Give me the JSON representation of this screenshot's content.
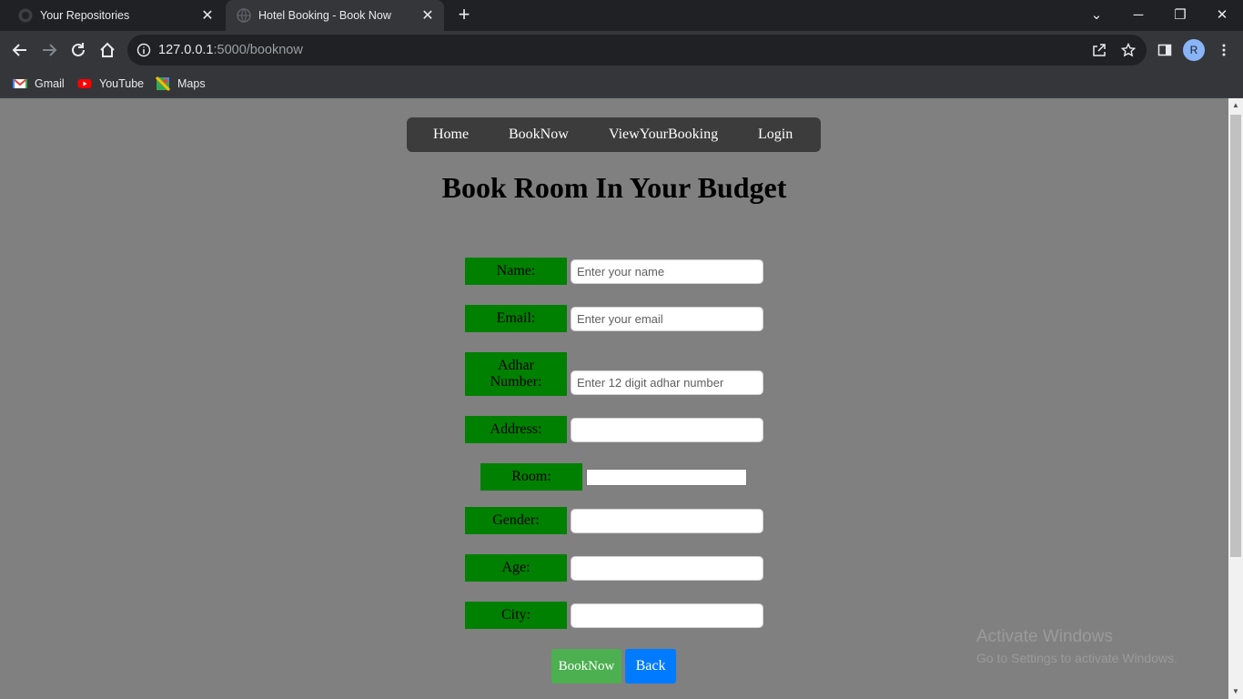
{
  "browser": {
    "tabs": [
      {
        "title": "Your Repositories",
        "icon": "github-icon"
      },
      {
        "title": "Hotel Booking - Book Now",
        "icon": "globe-icon"
      }
    ],
    "url_host": "127.0.0.1",
    "url_path": ":5000/booknow",
    "profile_initial": "R",
    "bookmarks": [
      {
        "label": "Gmail",
        "icon": "gmail-icon"
      },
      {
        "label": "YouTube",
        "icon": "youtube-icon"
      },
      {
        "label": "Maps",
        "icon": "maps-icon"
      }
    ]
  },
  "nav": {
    "home": "Home",
    "booknow": "BookNow",
    "viewbooking": "ViewYourBooking",
    "login": "Login"
  },
  "heading": "Book Room In Your Budget",
  "form": {
    "name_label": "Name:",
    "name_placeholder": "Enter your name",
    "email_label": "Email:",
    "email_placeholder": "Enter your email",
    "adhar_label": "Adhar Number:",
    "adhar_placeholder": "Enter 12 digit adhar number",
    "address_label": "Address:",
    "room_label": "Room:",
    "gender_label": "Gender:",
    "age_label": "Age:",
    "city_label": "City:",
    "submit_label": "BookNow",
    "back_label": "Back"
  },
  "watermark": {
    "line1": "Activate Windows",
    "line2": "Go to Settings to activate Windows."
  },
  "colors": {
    "label_bg": "#008000",
    "book_button": "#4caf50",
    "back_button": "#007bff",
    "page_bg": "#808080",
    "nav_bg": "#3c3c3c"
  }
}
